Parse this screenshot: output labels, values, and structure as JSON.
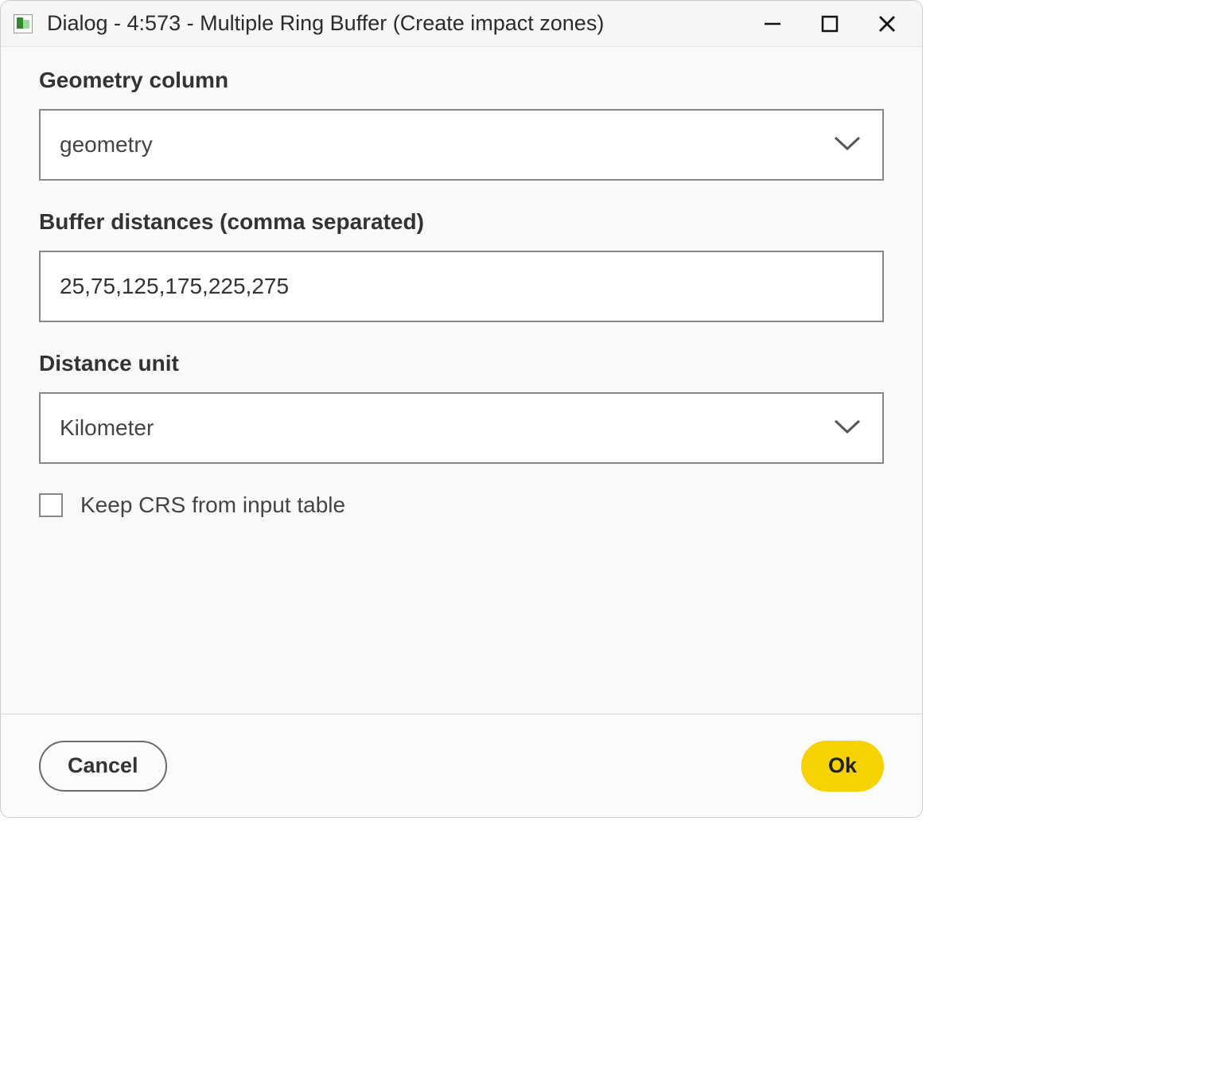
{
  "window": {
    "title": "Dialog - 4:573 - Multiple Ring Buffer (Create impact zones)"
  },
  "form": {
    "geometry": {
      "label": "Geometry column",
      "value": "geometry"
    },
    "distances": {
      "label": "Buffer distances (comma separated)",
      "value": "25,75,125,175,225,275"
    },
    "unit": {
      "label": "Distance unit",
      "value": "Kilometer"
    },
    "keep_crs": {
      "label": "Keep CRS from input table",
      "checked": false
    }
  },
  "footer": {
    "cancel": "Cancel",
    "ok": "Ok"
  }
}
